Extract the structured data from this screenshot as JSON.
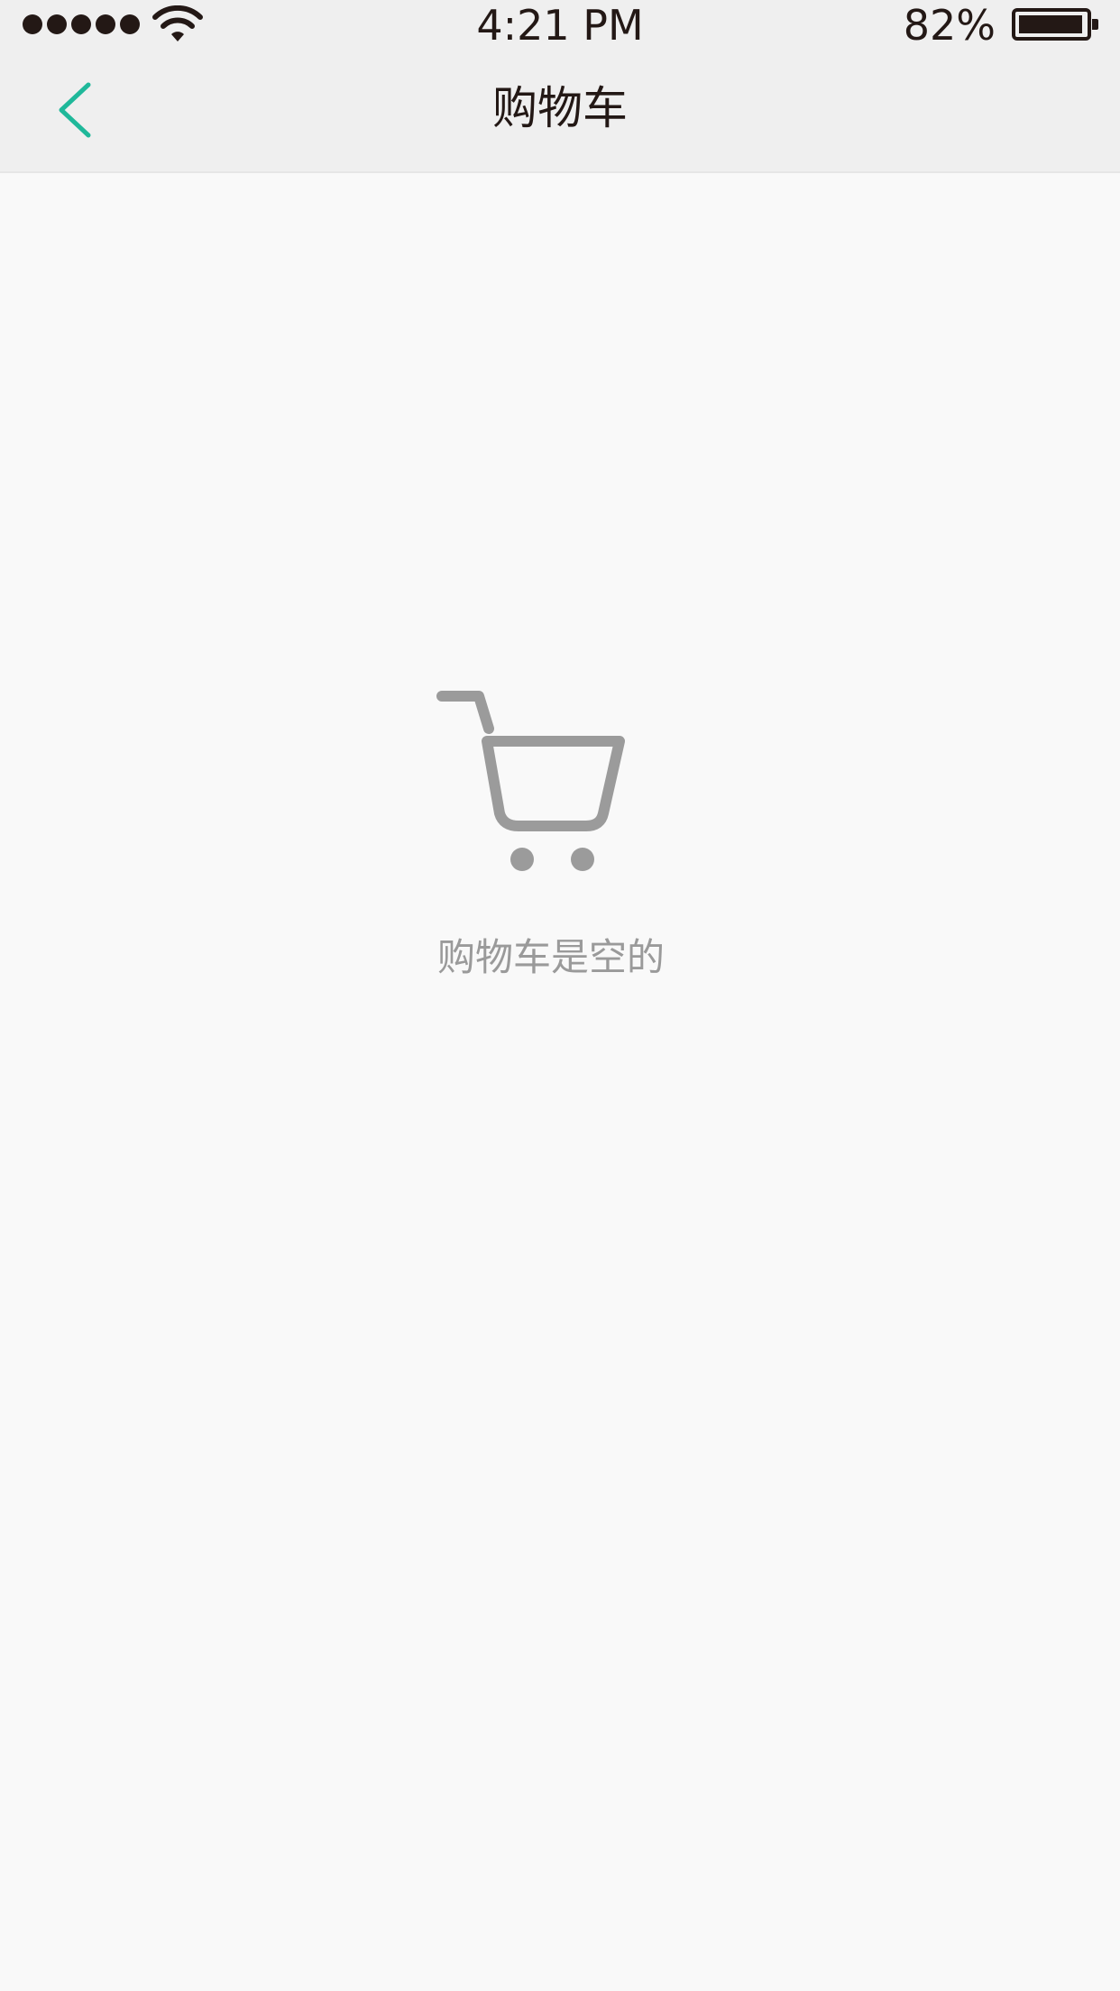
{
  "status_bar": {
    "time": "4:21 PM",
    "battery_percent": "82%",
    "signal_bars": 5,
    "battery_level": 0.82
  },
  "nav": {
    "title": "购物车",
    "back_icon": "chevron-left-icon"
  },
  "empty_state": {
    "icon": "shopping-cart-icon",
    "message": "购物车是空的"
  },
  "colors": {
    "accent": "#1fb89a",
    "text_dark": "#231815",
    "text_muted": "#9a9a9a",
    "icon_gray": "#9b9b9b",
    "nav_background": "#efefef",
    "page_background": "#f9f9f9"
  }
}
